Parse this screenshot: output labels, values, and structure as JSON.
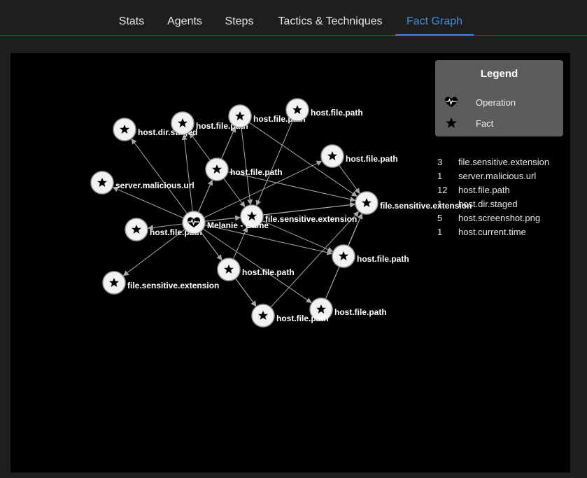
{
  "tabs": [
    {
      "label": "Stats",
      "active": false
    },
    {
      "label": "Agents",
      "active": false
    },
    {
      "label": "Steps",
      "active": false
    },
    {
      "label": "Tactics & Techniques",
      "active": false
    },
    {
      "label": "Fact Graph",
      "active": true
    }
  ],
  "colors": {
    "accent": "#3b8fe0",
    "divider": "#8a2a2a",
    "panel": "#000000",
    "legend_bg": "#5c5c5c",
    "edge": "#a8a8a8"
  },
  "legend": {
    "title": "Legend",
    "items": [
      {
        "icon": "heartbeat-icon",
        "label": "Operation"
      },
      {
        "icon": "star-icon",
        "label": "Fact"
      }
    ]
  },
  "fact_counts": [
    {
      "count": "3",
      "name": "file.sensitive.extension"
    },
    {
      "count": "1",
      "name": "server.malicious.url"
    },
    {
      "count": "12",
      "name": "host.file.path"
    },
    {
      "count": "1",
      "name": "host.dir.staged"
    },
    {
      "count": "5",
      "name": "host.screenshot.png"
    },
    {
      "count": "1",
      "name": "host.current.time"
    }
  ],
  "graph": {
    "operation": {
      "label": "Melanie - Game"
    },
    "facts": [
      "host.dir.staged",
      "host.file.path",
      "host.file.path",
      "host.file.path",
      "host.file.path",
      "host.file.path",
      "server.malicious.url",
      "file.sensitive.extension",
      "file.sensitive.extension",
      "host.file.path",
      "host.file.path",
      "host.file.path",
      "file.sensitive.extension",
      "host.file.path",
      "host.file.path"
    ]
  }
}
